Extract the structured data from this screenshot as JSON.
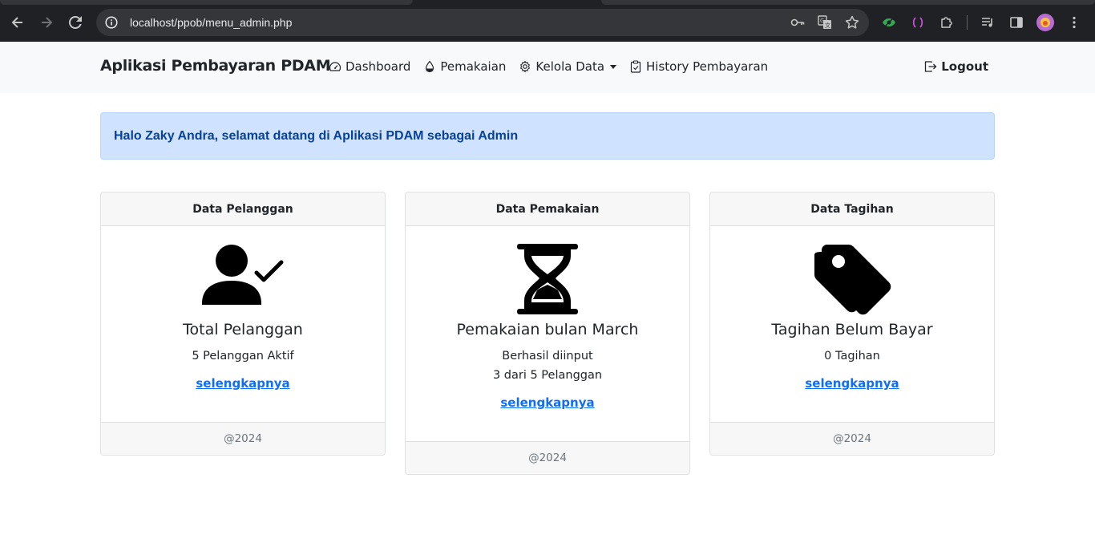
{
  "browser": {
    "url": "localhost/ppob/menu_admin.php",
    "icons": [
      "back-icon",
      "forward-icon",
      "reload-icon",
      "site-info-icon",
      "key-icon",
      "translate-icon",
      "bookmark-star-icon",
      "extension-eye-icon",
      "extension-brackets-icon",
      "extensions-puzzle-icon",
      "media-queue-icon",
      "side-panel-icon",
      "profile-avatar",
      "kebab-menu-icon"
    ]
  },
  "navbar": {
    "brand": "Aplikasi Pembayaran PDAM",
    "links": [
      {
        "label": "Dashboard",
        "icon": "speedometer-icon"
      },
      {
        "label": "Pemakaian",
        "icon": "droplet-icon"
      },
      {
        "label": "Kelola Data",
        "icon": "gear-icon",
        "dropdown": true
      },
      {
        "label": "History Pembayaran",
        "icon": "clipboard-icon"
      }
    ],
    "logout": "Logout"
  },
  "alert": {
    "text": "Halo Zaky Andra, selamat datang di Aplikasi PDAM sebagai Admin"
  },
  "cards": [
    {
      "header": "Data Pelanggan",
      "icon": "person-check-icon",
      "title": "Total Pelanggan",
      "lines": [
        "5 Pelanggan Aktif"
      ],
      "link": "selengkapnya",
      "footer": "@2024"
    },
    {
      "header": "Data Pemakaian",
      "icon": "hourglass-icon",
      "title": "Pemakaian bulan March",
      "lines": [
        "Berhasil diinput",
        "3 dari 5 Pelanggan"
      ],
      "link": "selengkapnya",
      "footer": "@2024"
    },
    {
      "header": "Data Tagihan",
      "icon": "tags-icon",
      "title": "Tagihan Belum Bayar",
      "lines": [
        "0 Tagihan"
      ],
      "link": "selengkapnya",
      "footer": "@2024"
    }
  ],
  "colors": {
    "chrome_bg": "#202124",
    "omnibox_bg": "#35363a",
    "navbar_bg": "#f8f9fa",
    "alert_bg": "#cfe2ff",
    "alert_text": "#084298",
    "link": "#0d6efd"
  }
}
